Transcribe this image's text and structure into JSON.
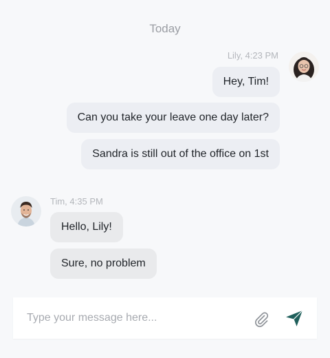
{
  "divider": {
    "label": "Today"
  },
  "lily_group": {
    "meta": "Lily, 4:23 PM",
    "messages": [
      "Hey, Tim!",
      "Can you take your leave one day later?",
      "Sandra is still out of the office on 1st"
    ]
  },
  "tim_group": {
    "meta": "Tim, 4:35 PM",
    "messages": [
      "Hello, Lily!",
      "Sure, no problem"
    ]
  },
  "composer": {
    "placeholder": "Type your message here...",
    "value": ""
  },
  "icons": {
    "attach": "paperclip-icon",
    "send": "send-icon"
  },
  "colors": {
    "accent": "#1f5f5b",
    "outgoing_bubble": "#eceef3",
    "incoming_bubble": "#e9eaec",
    "background": "#f7f8fa",
    "muted_text": "#9a9da3"
  }
}
